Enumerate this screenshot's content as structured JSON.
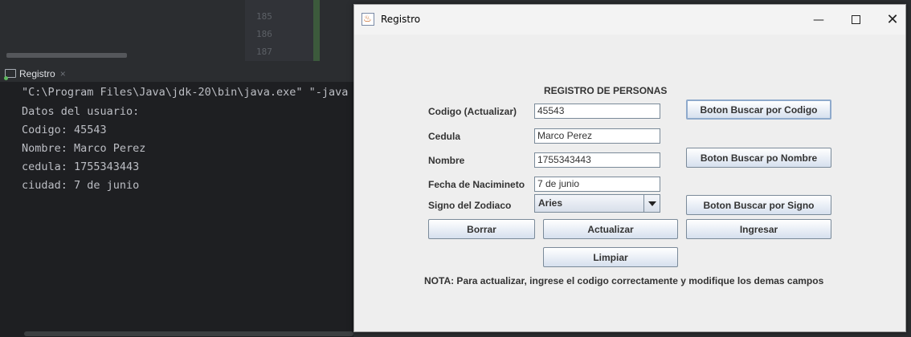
{
  "ide": {
    "line_numbers": [
      "185",
      "186",
      "187"
    ],
    "run_tab_label": "Registro",
    "run_tab_close": "×",
    "console_lines": [
      "\"C:\\Program Files\\Java\\jdk-20\\bin\\java.exe\" \"-java",
      "Datos del usuario:",
      "Codigo: 45543",
      "Nombre: Marco Perez",
      "cedula: 1755343443",
      "ciudad: 7 de junio"
    ]
  },
  "window": {
    "title": "Registro",
    "minimize": "—",
    "close": "✕"
  },
  "form": {
    "title": "REGISTRO DE PERSONAS",
    "labels": {
      "codigo": "Codigo (Actualizar)",
      "cedula": "Cedula",
      "nombre": "Nombre",
      "fecha": "Fecha de Nacimineto",
      "signo": "Signo del Zodiaco"
    },
    "values": {
      "codigo": "45543",
      "cedula": "Marco Perez",
      "nombre": "1755343443",
      "fecha": "7 de junio",
      "signo": "Aries"
    },
    "buttons": {
      "buscar_codigo": "Boton Buscar por Codigo",
      "buscar_nombre": "Boton Buscar po Nombre",
      "buscar_signo": "Boton Buscar por Signo",
      "borrar": "Borrar",
      "actualizar": "Actualizar",
      "ingresar": "Ingresar",
      "limpiar": "Limpiar"
    },
    "nota": "NOTA: Para actualizar, ingrese el codigo correctamente y modifique los demas campos"
  }
}
